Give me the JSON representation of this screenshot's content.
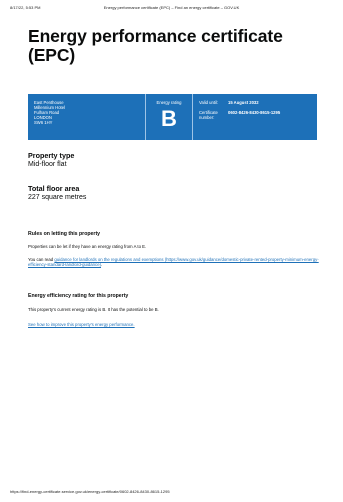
{
  "print_header": {
    "date": "8/17/22, 5:53 PM",
    "title": "Energy performance certificate (EPC) – Find an energy certificate – GOV.UK"
  },
  "page_title": "Energy performance certificate (EPC)",
  "certificate": {
    "address_lines": [
      "East Penthouse",
      "Millennium Hotel",
      "Fulham Road",
      "LONDON",
      "SW6 1HY"
    ],
    "rating_label": "Energy rating",
    "rating_value": "B",
    "valid_label": "Valid until:",
    "valid_value": "15 August 2032",
    "cert_label_1": "Certificate",
    "cert_label_2": "number:",
    "cert_value": "0602-8426-8430-8615-1295"
  },
  "property_type": {
    "heading": "Property type",
    "value": "Mid-floor flat"
  },
  "floor_area": {
    "heading": "Total floor area",
    "value": "227 square metres"
  },
  "letting": {
    "heading": "Rules on letting this property",
    "para1": "Properties can be let if they have an energy rating from A to E.",
    "para2_prefix": "You can read ",
    "para2_link": "guidance for landlords on the regulations and exemptions (https://www.gov.uk/guidance/domestic-private-rented-property-minimum-energy-efficiency-standard-landlord-guidance)",
    "para2_suffix": "."
  },
  "efficiency": {
    "heading": "Energy efficiency rating for this property",
    "para": "This property's current energy rating is B. It has the potential to be B.",
    "link": "See how to improve this property's energy performance."
  },
  "footer_url": "https://find-energy-certificate.service.gov.uk/energy-certificate/0602-8426-8430-8615-1295"
}
